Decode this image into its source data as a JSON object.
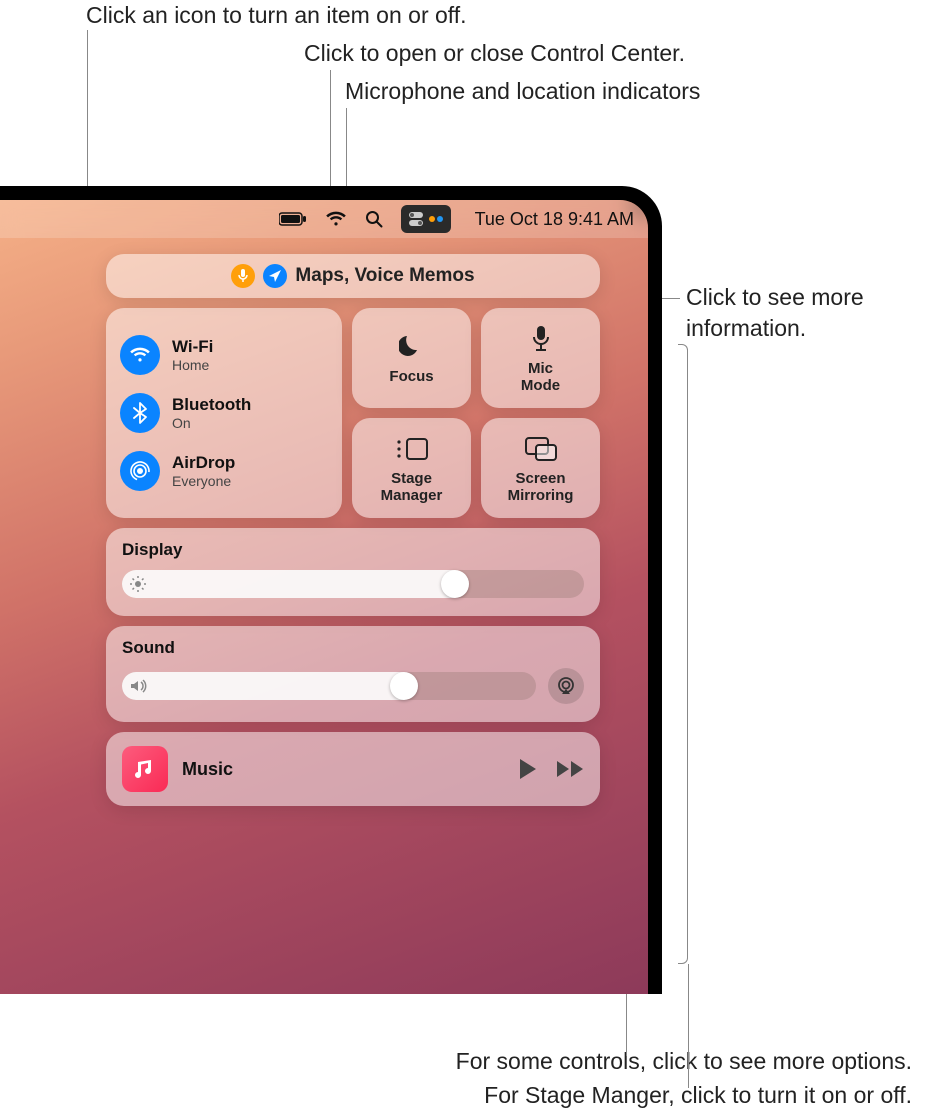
{
  "callouts": {
    "toggle_icon": "Click an icon to turn an item on or off.",
    "open_cc": "Click to open or close Control Center.",
    "indicators": "Microphone and location indicators",
    "more_info": "Click to see more\ninformation.",
    "more_options": "For some controls, click to see more options.",
    "stage_manager_note": "For Stage Manger, click to turn it on or off."
  },
  "menubar": {
    "datetime": "Tue Oct 18  9:41 AM"
  },
  "sensors": {
    "apps_label": "Maps, Voice Memos"
  },
  "connectivity": {
    "wifi": {
      "title": "Wi-Fi",
      "subtitle": "Home"
    },
    "bluetooth": {
      "title": "Bluetooth",
      "subtitle": "On"
    },
    "airdrop": {
      "title": "AirDrop",
      "subtitle": "Everyone"
    }
  },
  "tiles": {
    "focus": "Focus",
    "mic_mode": "Mic\nMode",
    "stage_manager": "Stage\nManager",
    "screen_mirroring": "Screen\nMirroring"
  },
  "sliders": {
    "display": {
      "title": "Display",
      "value_pct": 72
    },
    "sound": {
      "title": "Sound",
      "value_pct": 68
    }
  },
  "media": {
    "title": "Music"
  },
  "colors": {
    "accent_blue": "#0a84ff",
    "indicator_orange": "#ff9f0a"
  }
}
